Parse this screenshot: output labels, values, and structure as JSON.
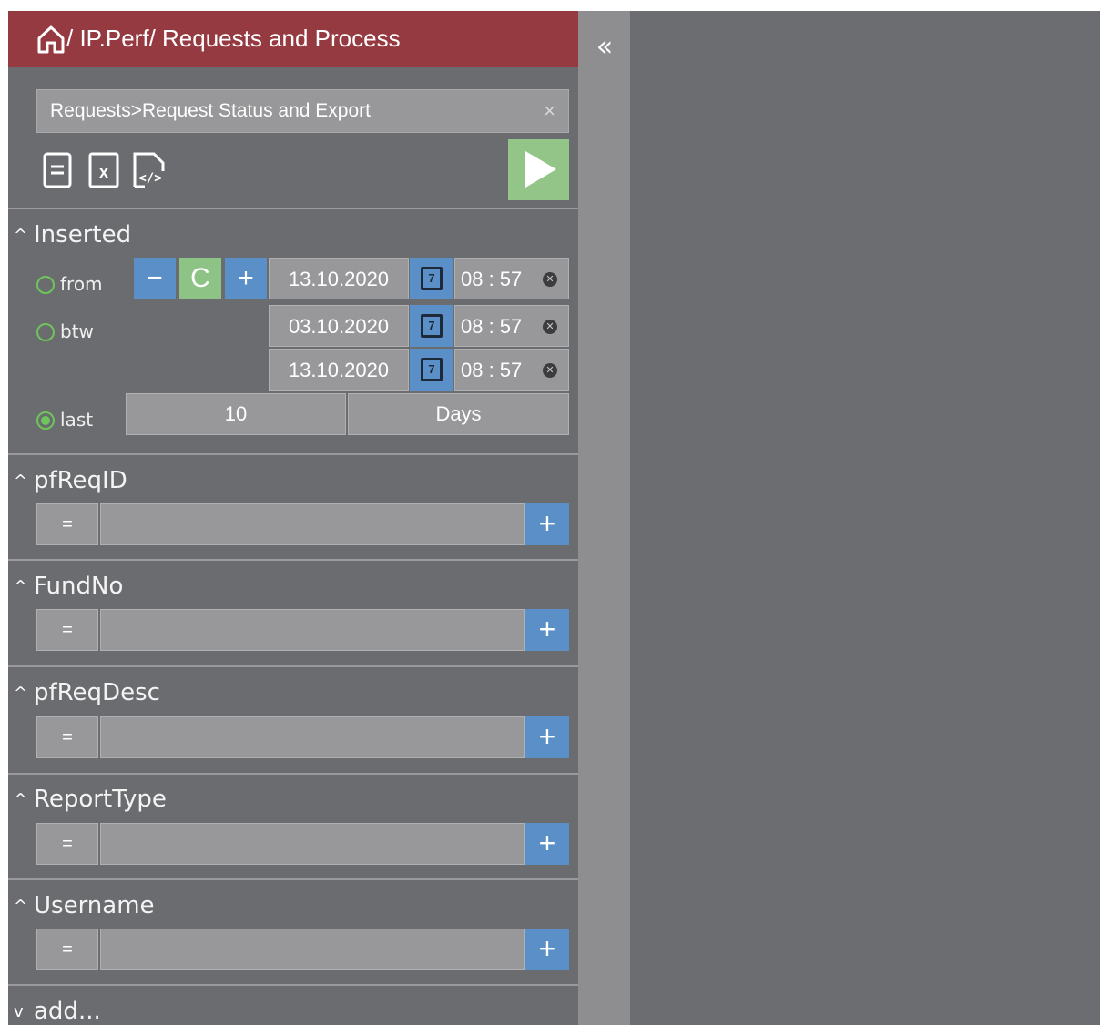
{
  "header": {
    "home_icon": "home-icon",
    "breadcrumb": "/ IP.Perf/ Requests and Process"
  },
  "collapse": {
    "label": "«"
  },
  "report_select": {
    "value": "Requests>Request Status and Export",
    "clear": "×"
  },
  "toolbar": {
    "icons": [
      "document-icon",
      "excel-icon",
      "xml-icon"
    ],
    "run": "play-icon"
  },
  "inserted": {
    "title": "Inserted",
    "from_label": "from",
    "btw_label": "btw",
    "last_label": "last",
    "selected": "last",
    "from_date": "13.10.2020",
    "from_time": "08 : 57",
    "btw_start_date": "03.10.2020",
    "btw_start_time": "08 : 57",
    "btw_end_date": "13.10.2020",
    "btw_end_time": "08 : 57",
    "last_value": "10",
    "last_unit": "Days",
    "minus": "−",
    "reset": "C",
    "plus": "+",
    "calendar_day": "7",
    "clear": "✕"
  },
  "filters": [
    {
      "title": "pfReqID",
      "operator": "=",
      "value": "",
      "add": "+"
    },
    {
      "title": "FundNo",
      "operator": "=",
      "value": "",
      "add": "+"
    },
    {
      "title": "pfReqDesc",
      "operator": "=",
      "value": "",
      "add": "+"
    },
    {
      "title": "ReportType",
      "operator": "=",
      "value": "",
      "add": "+"
    },
    {
      "title": "Username",
      "operator": "=",
      "value": "",
      "add": "+"
    }
  ],
  "add_section": {
    "label": "add..."
  },
  "colors": {
    "header": "#963a42",
    "panel": "#6b6c6f",
    "accent_blue": "#5b8fc8",
    "accent_green": "#8ec386",
    "radio_green": "#6ec55b"
  }
}
